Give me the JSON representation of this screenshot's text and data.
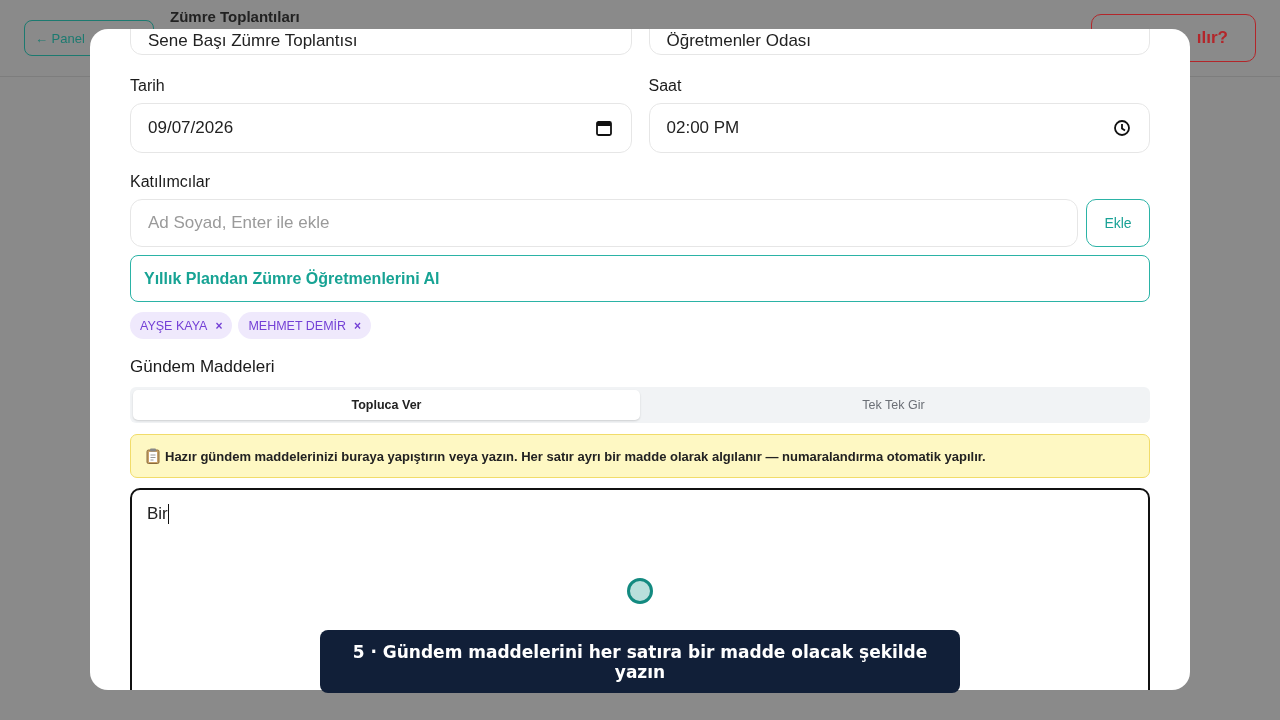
{
  "background": {
    "back_button": "← Panel",
    "page_title": "Zümre Toplantıları",
    "help_button": "ılır?"
  },
  "modal": {
    "fields": [
      {
        "kind": "text",
        "value": "Sene Başı Zümre Toplantısı"
      },
      {
        "kind": "text",
        "value": "Öğretmenler Odası"
      },
      {
        "kind": "date",
        "label": "Tarih",
        "value": "09/07/2026"
      },
      {
        "kind": "time",
        "label": "Saat",
        "value": "02:00 PM"
      }
    ],
    "participants": {
      "label": "Katılımcılar",
      "placeholder": "Ad Soyad, Enter ile ekle",
      "add_button": "Ekle",
      "import_button": "Yıllık Plandan Zümre Öğretmenlerini Al",
      "chips": [
        {
          "name": "AYŞE KAYA",
          "remove": "×"
        },
        {
          "name": "MEHMET DEMİR",
          "remove": "×"
        }
      ]
    },
    "agenda": {
      "label": "Gündem Maddeleri",
      "tabs": [
        {
          "label": "Topluca Ver",
          "selected": true
        },
        {
          "label": "Tek Tek Gir",
          "selected": false
        }
      ],
      "note": "Hazır gündem maddelerinizi buraya yapıştırın veya yazın. Her satır ayrı bir madde olarak algılanır — numaralandırma otomatik yapılır.",
      "text": "Bir"
    }
  },
  "tooltip": "5 · Gündem maddelerini her satıra bir madde olacak şekilde yazın"
}
